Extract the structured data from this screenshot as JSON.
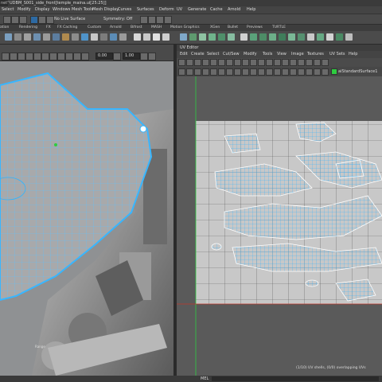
{
  "window": {
    "title_prefix": "net\"",
    "title": "UDBM_S001_side_front[temple_maina.ui[25:25]]"
  },
  "main_menu": [
    "Select",
    "Modify",
    "Display",
    "Windows",
    "Mesh Tools",
    "Mesh Display",
    "Curves",
    "Surfaces",
    "Deform",
    "UV",
    "Generate",
    "Cache",
    "Arnold",
    "Help"
  ],
  "status_line": {
    "live_surface": "No Live Surface",
    "symmetry": "Symmetry: Off"
  },
  "shelf_tabs": [
    "ation",
    "Rendering",
    "FX",
    "FX Caching",
    "Custom",
    "Arnold",
    "Bifrost",
    "MASH",
    "Motion Graphics",
    "XGen",
    "Bullet",
    "Previews",
    "TURTLE"
  ],
  "viewport": {
    "field_a": "0.00",
    "field_b": "1.00",
    "corner_label": "Range"
  },
  "uv_editor": {
    "title": "UV Editor",
    "menu": [
      "Edit",
      "Create",
      "Select",
      "Cut/Sew",
      "Modify",
      "Tools",
      "View",
      "Image",
      "Textures",
      "UV Sets",
      "Help"
    ],
    "material": "aiStandardSurface1",
    "status": "(1/10) UV shells, (0/0) overlapping UVs"
  },
  "help_line": {
    "label": "MEL"
  },
  "colors": {
    "uv_wire": "#2fb4ff",
    "uv_tile": "#c8c8c8",
    "viewport_bg": "#8e9092",
    "panel": "#444444"
  }
}
